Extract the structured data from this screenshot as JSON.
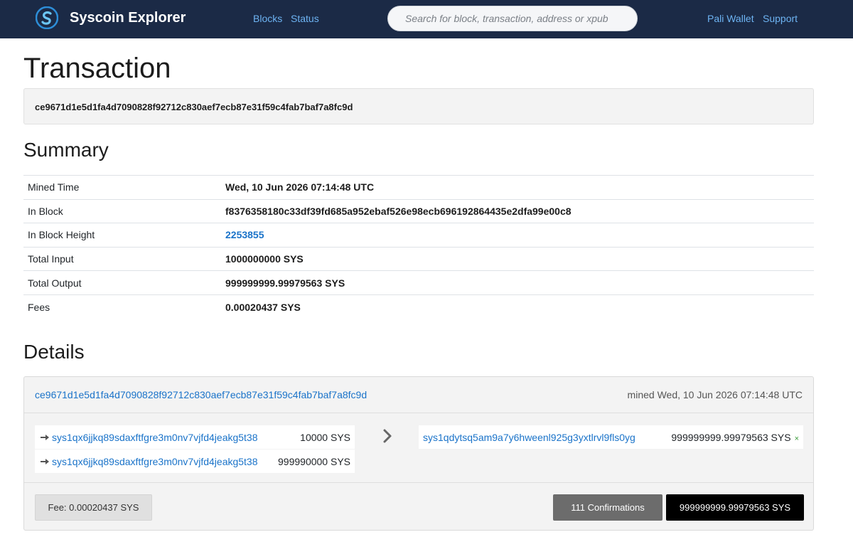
{
  "navbar": {
    "brand": "Syscoin Explorer",
    "links_left": [
      "Blocks",
      "Status"
    ],
    "search_placeholder": "Search for block, transaction, address or xpub",
    "links_right": [
      "Pali Wallet",
      "Support"
    ],
    "logo_icon": "syscoin-logo-icon"
  },
  "page": {
    "title": "Transaction",
    "txid": "ce9671d1e5d1fa4d7090828f92712c830aef7ecb87e31f59c4fab7baf7a8fc9d"
  },
  "summary": {
    "heading": "Summary",
    "rows": [
      {
        "label": "Mined Time",
        "value": "Wed, 10 Jun 2026 07:14:48 UTC"
      },
      {
        "label": "In Block",
        "value": "f8376358180c33df39fd685a952ebaf526e98ecb696192864435e2dfa99e00c8"
      },
      {
        "label": "In Block Height",
        "value": "2253855"
      },
      {
        "label": "Total Input",
        "value": "1000000000 SYS"
      },
      {
        "label": "Total Output",
        "value": "999999999.99979563 SYS"
      },
      {
        "label": "Fees",
        "value": "0.00020437 SYS"
      }
    ]
  },
  "details": {
    "heading": "Details",
    "txid": "ce9671d1e5d1fa4d7090828f92712c830aef7ecb87e31f59c4fab7baf7a8fc9d",
    "mined": "mined Wed, 10 Jun 2026 07:14:48 UTC",
    "inputs": [
      {
        "address": "sys1qx6jjkq89sdaxftfgre3m0nv7vjfd4jeakg5t38",
        "amount": "10000 SYS"
      },
      {
        "address": "sys1qx6jjkq89sdaxftfgre3m0nv7vjfd4jeakg5t38",
        "amount": "999990000 SYS"
      }
    ],
    "outputs": [
      {
        "address": "sys1qdytsq5am9a7y6hweenl925g3yxtlrvl9fls0yg",
        "amount": "999999999.99979563 SYS",
        "status_mark": "×"
      }
    ],
    "fee": "Fee: 0.00020437 SYS",
    "confirmations": "111 Confirmations",
    "total": "999999999.99979563 SYS"
  },
  "colors": {
    "navbar_bg": "#1b2a46",
    "link": "#1a73c9",
    "nav_link": "#6db3f2",
    "confirm_bg": "#6c6c6c",
    "total_bg": "#000000"
  }
}
